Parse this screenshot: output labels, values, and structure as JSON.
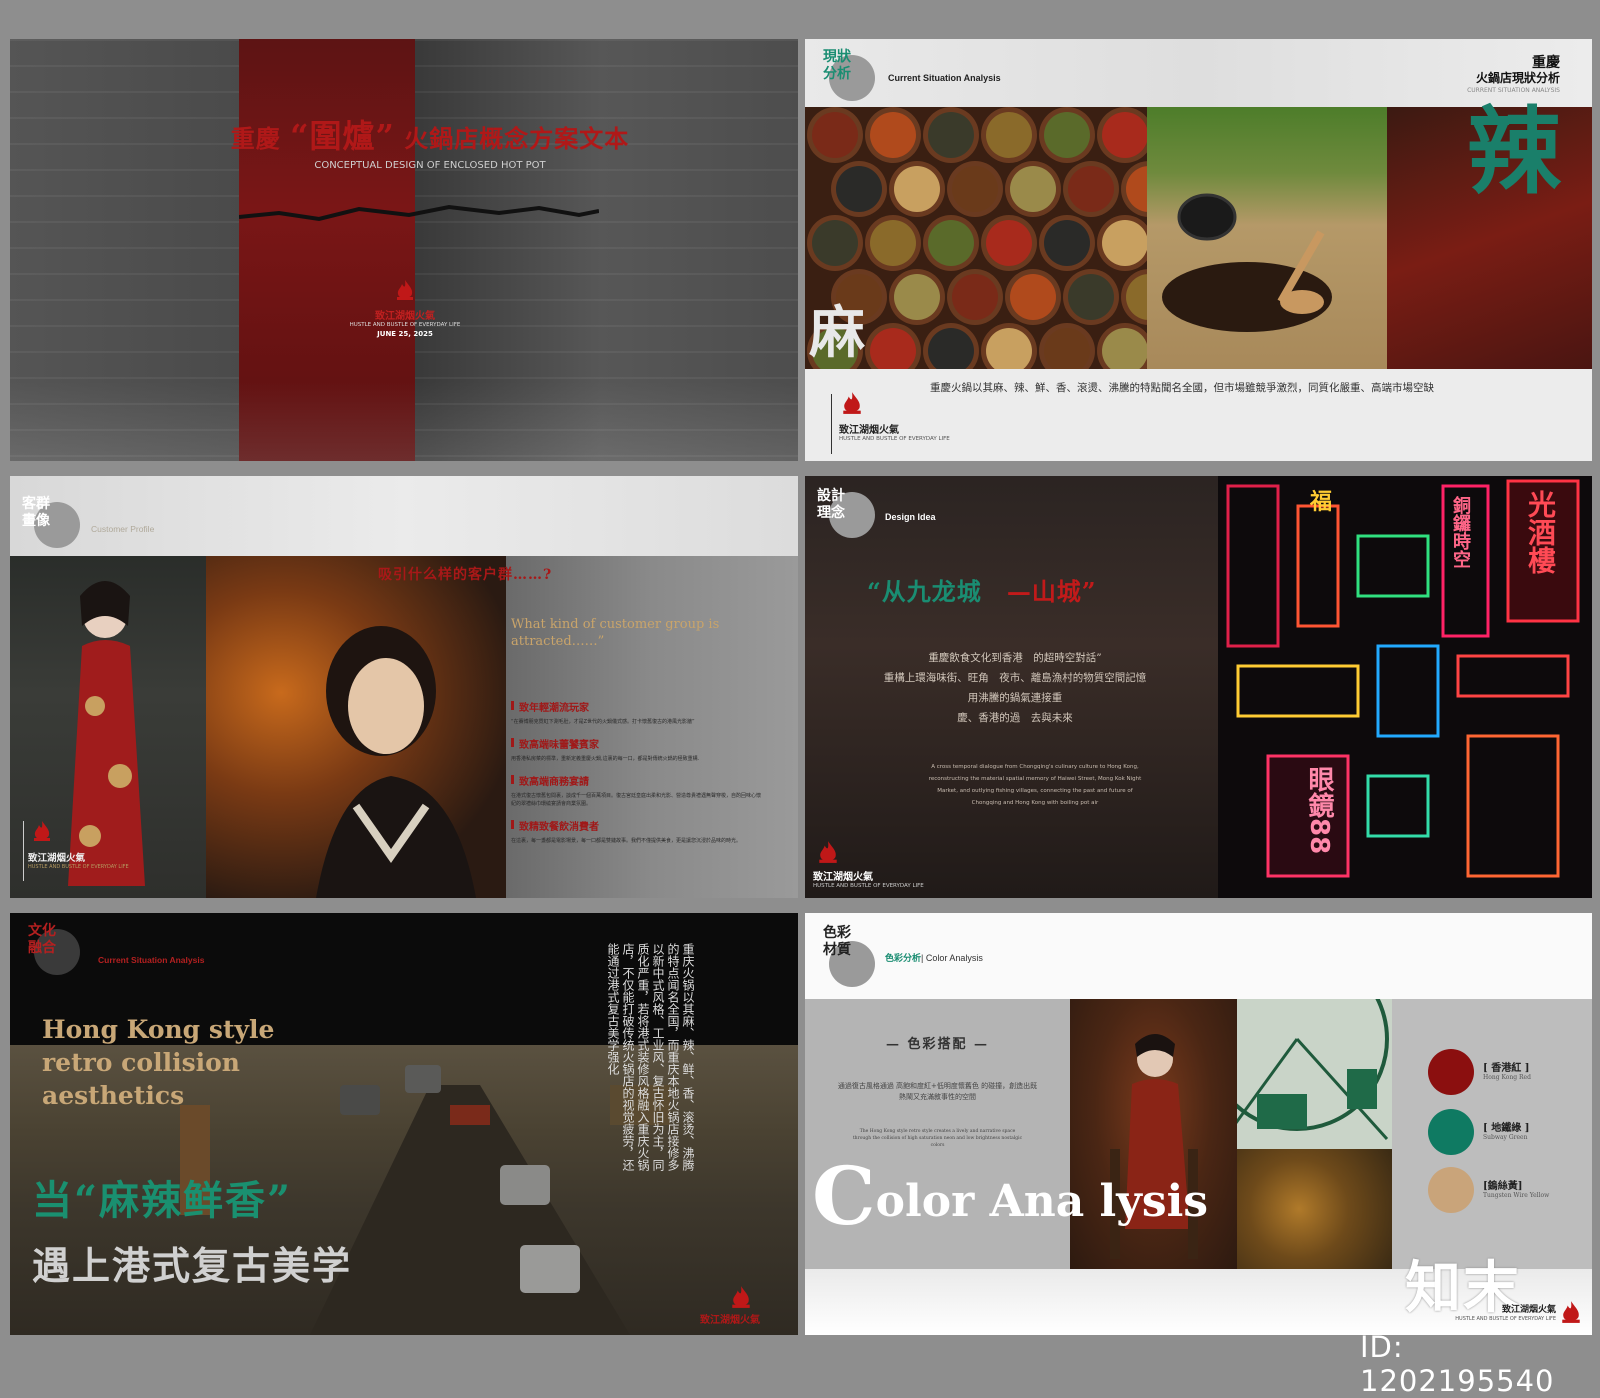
{
  "slide1": {
    "title_a": "重慶",
    "title_b": "“圍爐”",
    "title_c": "火鍋店概念方案文本",
    "subtitle": "CONCEPTUAL DESIGN OF ENCLOSED HOT POT",
    "brand_name": "致江湖烟火氣",
    "brand_en": "HUSTLE AND BUSTLE OF EVERYDAY LIFE",
    "date": "JUNE 25, 2025"
  },
  "slide2": {
    "section": "現狀分析",
    "section_en": "Current Situation Analysis",
    "right_title_1": "重慶",
    "right_title_2": "火鍋店現狀分析",
    "right_title_en": "CURRENT SITUATION ANALYSIS",
    "char_ma": "麻",
    "char_la": "辣",
    "description": "重慶火鍋以其麻、辣、鮮、香、滾燙、沸騰的特點聞名全國，但市場雖競爭激烈，同質化嚴重、高端市場空缺",
    "brand_name": "致江湖烟火氣",
    "brand_en": "HUSTLE AND BUSTLE OF EVERYDAY LIFE"
  },
  "slide3": {
    "section": "客群畫像",
    "section_en": "Customer Profile",
    "question": "吸引什么样的客户群……?",
    "question_en": "What kind of customer group is attracted……”",
    "items": [
      {
        "h": "致年輕潮流玩家",
        "t": "“在賽博朋克霓虹下涮毛肚，才是Z世代的火鍋儀式感。打卡懷舊復古的港風光影牆”"
      },
      {
        "h": "致高端味蕾饕賓家",
        "t": "用香港私房菜的標準，重新定義重慶火鍋,這裏的每一口，都是對傳統火鍋的極致重構."
      },
      {
        "h": "致高端商務宴請",
        "t": "在港式復古懷舊包間裏，談成千一個百萬項目。復古宮廷皇庭出柔和光影、營造尊貴禮遇無聲穿梭，自酌回味心懷紀的翠禮絲巾環繞宴請會商業氛圍。"
      },
      {
        "h": "致精致餐飲消費者",
        "t": "在這裏，每一盞都是電影場景，每一口都是雙鏈故事。我們不僅提供美食，更是讓您沉浸於品味的時光。"
      }
    ],
    "brand_name": "致江湖烟火氣",
    "brand_en": "HUSTLE AND BUSTLE OF EVERYDAY LIFE"
  },
  "slide4": {
    "section": "設計理念",
    "section_en": "Design Idea",
    "headline_a": "“从九龙城",
    "headline_b": "—山城”",
    "cn_lines": [
      "重慶飲食文化到香港　的超時空對話”",
      "重構上環海味街、旺角　夜市、離島漁村的物質空間記憶",
      "用沸騰的鍋氣連接重",
      "慶、香港的過　去與未來"
    ],
    "en_lines": [
      "A cross temporal dialogue from Chongqing's culinary culture to Hong Kong,",
      "reconstructing the material spatial memory of Haiwei Street, Mong Kok Night",
      "Market, and outlying fishing villages, connecting the past and future of",
      "Chongqing and Hong Kong with boiling pot air"
    ],
    "neon_signs": [
      "光酒樓",
      "銅鑼時空",
      "眼鏡88",
      "福"
    ],
    "brand_name": "致江湖烟火氣",
    "brand_en": "HUSTLE AND BUSTLE OF EVERYDAY LIFE"
  },
  "slide5": {
    "section": "文化融合",
    "section_en": "Current Situation Analysis",
    "english_lines": [
      "Hong Kong style",
      "retro collision",
      "aesthetics"
    ],
    "headline_1": "当“麻辣鲜香”",
    "headline_2": "遇上港式复古美学",
    "vertical_columns": [
      "重庆火锅以其麻、辣、鲜、香、滚烫、沸腾",
      "的特点闻名全国，而重庆本地火锅店接修多",
      "以新中式风格、工业风、复古怀旧为主，同",
      "质化严重，若将港式装修风格融入重庆火锅",
      "店，不仅能打破传统火锅店的视觉疲劳，还",
      "能通过港式复古美学强化"
    ],
    "brand_name": "致江湖烟火氣"
  },
  "slide6": {
    "section": "色彩材質",
    "section_en_green": "色彩分析",
    "section_en": "| Color Analysis",
    "matching_title": "— 色彩搭配 —",
    "cn_text": "通過復古風格通過 高飽和度紅+低明度懷舊色 的碰撞，創造出既熱鬧又充滿敘事性的空間",
    "en_text": "The Hong Kong style retro style creates a lively and narrative space through the collision of high saturation neon and low brightness nostalgic colors",
    "big_word_c": "C",
    "big_word_rest": "olor Ana lysis",
    "swatches": [
      {
        "label": "[ 香港紅 ]",
        "en": "Hong Kong Red",
        "color": "#8b0f0f"
      },
      {
        "label": "[ 地鐵綠 ]",
        "en": "Subway Green",
        "color": "#0f7a62"
      },
      {
        "label": "[鎢絲黃]",
        "en": "Tungsten Wire Yellow",
        "color": "#c9a47a"
      }
    ],
    "logo": "知末",
    "brand_name": "致江湖烟火氣",
    "brand_en": "HUSTLE AND BUSTLE OF EVERYDAY LIFE"
  },
  "id_text": "ID: 1202195540",
  "colors": {
    "brand_red": "#b01818",
    "jade_green": "#1a8d72",
    "gold": "#c8a777"
  }
}
